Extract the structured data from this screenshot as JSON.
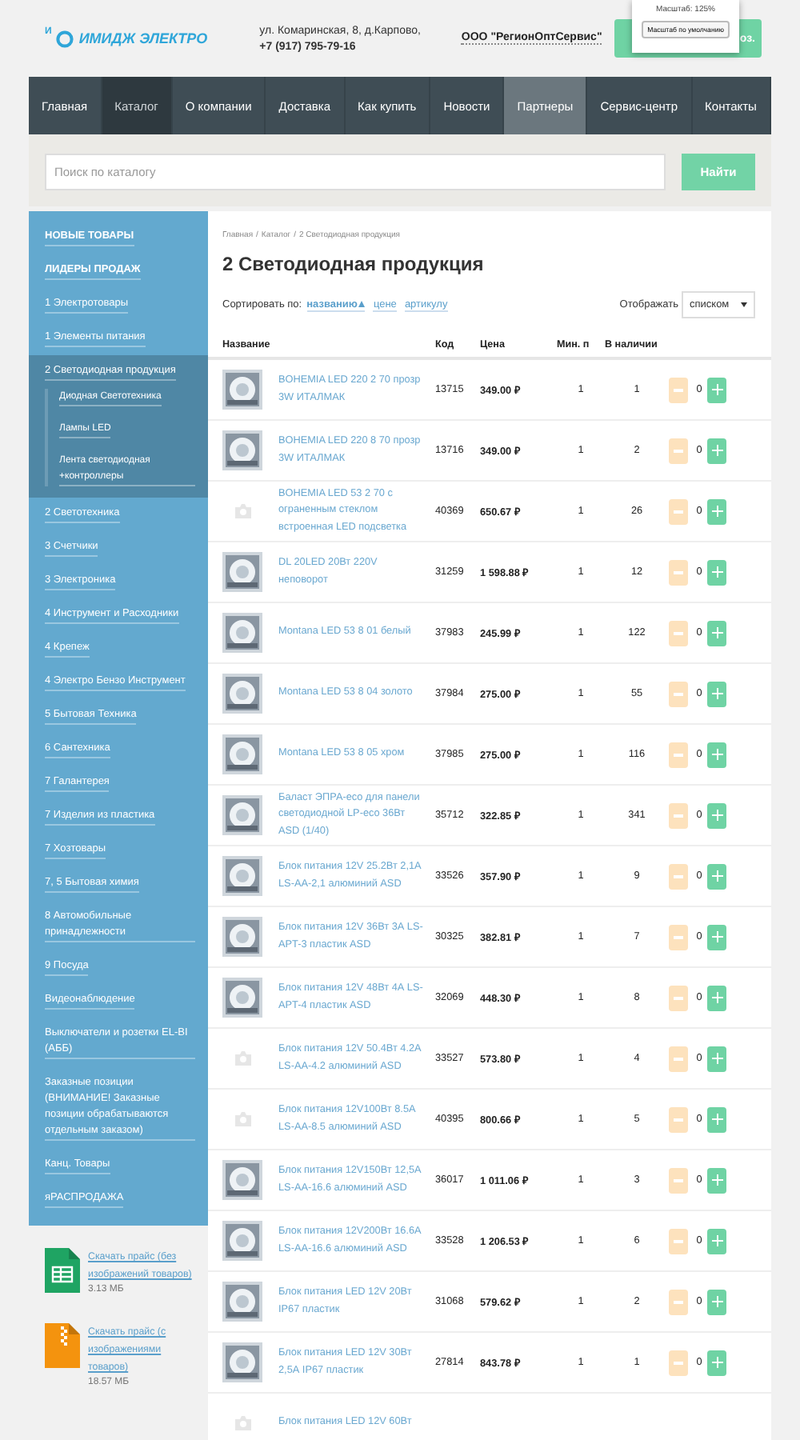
{
  "header": {
    "logo_mark": "И",
    "logo_text": "ИМИДЖ ЭЛЕКТРО",
    "address": "ул. Комаринская, 8, д.Карпово,",
    "phone": "+7 (917) 795-79-16",
    "company": "ООО \"РегионОптСервис\"",
    "cta_visible_text": "оз."
  },
  "zoom_popup": {
    "title": "Масштаб: 125%",
    "button": "Масштаб по умолчанию"
  },
  "nav": [
    {
      "label": "Главная",
      "selected": false,
      "highlighted": false
    },
    {
      "label": "Каталог",
      "selected": true,
      "highlighted": false
    },
    {
      "label": "О компании",
      "selected": false,
      "highlighted": false
    },
    {
      "label": "Доставка",
      "selected": false,
      "highlighted": false
    },
    {
      "label": "Как купить",
      "selected": false,
      "highlighted": false
    },
    {
      "label": "Новости",
      "selected": false,
      "highlighted": false
    },
    {
      "label": "Партнеры",
      "selected": false,
      "highlighted": true
    },
    {
      "label": "Сервис-центр",
      "selected": false,
      "highlighted": false
    },
    {
      "label": "Контакты",
      "selected": false,
      "highlighted": false
    }
  ],
  "search": {
    "placeholder": "Поиск по каталогу",
    "button": "Найти"
  },
  "sidebar": {
    "items": [
      {
        "label": "НОВЫЕ ТОВАРЫ",
        "selected": false,
        "bold": true
      },
      {
        "label": "ЛИДЕРЫ ПРОДАЖ",
        "selected": false,
        "bold": true
      },
      {
        "label": "1 Электротовары",
        "selected": false,
        "bold": false
      },
      {
        "label": "1 Элементы питания",
        "selected": false,
        "bold": false
      },
      {
        "label": "2 Светодиодная продукция",
        "selected": true,
        "bold": false,
        "children": [
          {
            "label": "Диодная Светотехника"
          },
          {
            "label": "Лампы LED"
          },
          {
            "label": "Лента светодиодная +контроллеры"
          }
        ]
      },
      {
        "label": "2 Светотехника",
        "selected": false,
        "bold": false
      },
      {
        "label": "3 Счетчики",
        "selected": false,
        "bold": false
      },
      {
        "label": "3 Электроника",
        "selected": false,
        "bold": false
      },
      {
        "label": "4 Инструмент и Расходники",
        "selected": false,
        "bold": false
      },
      {
        "label": "4 Крепеж",
        "selected": false,
        "bold": false
      },
      {
        "label": "4 Электро Бензо Инструмент",
        "selected": false,
        "bold": false
      },
      {
        "label": "5 Бытовая Техника",
        "selected": false,
        "bold": false
      },
      {
        "label": "6 Сантехника",
        "selected": false,
        "bold": false
      },
      {
        "label": "7 Галантерея",
        "selected": false,
        "bold": false
      },
      {
        "label": "7 Изделия из пластика",
        "selected": false,
        "bold": false
      },
      {
        "label": "7 Хозтовары",
        "selected": false,
        "bold": false
      },
      {
        "label": "7, 5 Бытовая химия",
        "selected": false,
        "bold": false
      },
      {
        "label": "8 Автомобильные принадлежности",
        "selected": false,
        "bold": false
      },
      {
        "label": "9 Посуда",
        "selected": false,
        "bold": false
      },
      {
        "label": "Видеонаблюдение",
        "selected": false,
        "bold": false
      },
      {
        "label": "Выключатели и розетки EL-BI (АББ)",
        "selected": false,
        "bold": false
      },
      {
        "label": "Заказные позиции (ВНИМАНИЕ! Заказные позиции обрабатываются отдельным заказом)",
        "selected": false,
        "bold": false
      },
      {
        "label": "Канц. Товары",
        "selected": false,
        "bold": false
      },
      {
        "label": "яРАСПРОДАЖА",
        "selected": false,
        "bold": false
      }
    ]
  },
  "downloads": [
    {
      "kind": "spreadsheet",
      "link": "Скачать прайс (без изображений товаров)",
      "size": "3.13 МБ"
    },
    {
      "kind": "archive",
      "link": "Скачать прайс (с изображениями товаров)",
      "size": "18.57 МБ"
    }
  ],
  "breadcrumbs": {
    "separator": "/",
    "items": [
      "Главная",
      "Каталог",
      "2 Светодиодная продукция"
    ]
  },
  "title": "2 Светодиодная продукция",
  "sort": {
    "label": "Сортировать по:",
    "options": [
      {
        "label": "названию",
        "selected": true
      },
      {
        "label": "цене",
        "selected": false
      },
      {
        "label": "артикулу",
        "selected": false
      }
    ]
  },
  "display": {
    "label": "Отображать",
    "value": "списком"
  },
  "table": {
    "columns": [
      "Название",
      "Код",
      "Цена",
      "Мин. п",
      "В наличии"
    ],
    "rows": [
      {
        "name": "BOHEMIA LED 220 2 70 прозр 3W ИТАЛМАК",
        "code": "13715",
        "price": "349.00 ₽",
        "min": "1",
        "stock": "1",
        "qty": "0"
      },
      {
        "name": "BOHEMIA LED 220 8 70 прозр 3W ИТАЛМАК",
        "code": "13716",
        "price": "349.00 ₽",
        "min": "1",
        "stock": "2",
        "qty": "0"
      },
      {
        "kind": "placeholder",
        "name": "BOHEMIA LED 53 2 70 с ограненным стеклом встроенная LED подсветка",
        "code": "40369",
        "price": "650.67 ₽",
        "min": "1",
        "stock": "26",
        "qty": "0"
      },
      {
        "name": "DL 20LED 20Вт 220V неповорот",
        "code": "31259",
        "price": "1 598.88 ₽",
        "min": "1",
        "stock": "12",
        "qty": "0"
      },
      {
        "name": "Montana LED 53 8 01 белый",
        "code": "37983",
        "price": "245.99 ₽",
        "min": "1",
        "stock": "122",
        "qty": "0"
      },
      {
        "name": "Montana LED 53 8 04 золото",
        "code": "37984",
        "price": "275.00 ₽",
        "min": "1",
        "stock": "55",
        "qty": "0"
      },
      {
        "name": "Montana LED 53 8 05 хром",
        "code": "37985",
        "price": "275.00 ₽",
        "min": "1",
        "stock": "116",
        "qty": "0"
      },
      {
        "name": "Баласт ЭПРА-eco для панели светодиодной LP-eco 36Вт ASD (1/40)",
        "code": "35712",
        "price": "322.85 ₽",
        "min": "1",
        "stock": "341",
        "qty": "0"
      },
      {
        "name": "Блок питания 12V 25.2Вт 2,1А LS-AA-2,1 алюминий ASD",
        "code": "33526",
        "price": "357.90 ₽",
        "min": "1",
        "stock": "9",
        "qty": "0"
      },
      {
        "name": "Блок питания 12V 36Вт 3А LS-APT-3 пластик ASD",
        "code": "30325",
        "price": "382.81 ₽",
        "min": "1",
        "stock": "7",
        "qty": "0"
      },
      {
        "name": "Блок питания 12V 48Вт 4А LS-APT-4 пластик ASD",
        "code": "32069",
        "price": "448.30 ₽",
        "min": "1",
        "stock": "8",
        "qty": "0"
      },
      {
        "kind": "placeholder",
        "name": "Блок питания 12V 50.4Вт 4.2А LS-AA-4.2 алюминий ASD",
        "code": "33527",
        "price": "573.80 ₽",
        "min": "1",
        "stock": "4",
        "qty": "0"
      },
      {
        "kind": "placeholder",
        "name": "Блок питания 12V100Вт 8.5А LS-AA-8.5 алюминий ASD",
        "code": "40395",
        "price": "800.66 ₽",
        "min": "1",
        "stock": "5",
        "qty": "0"
      },
      {
        "name": "Блок питания 12V150Вт 12,5А LS-AA-16.6 алюминий ASD",
        "code": "36017",
        "price": "1 011.06 ₽",
        "min": "1",
        "stock": "3",
        "qty": "0"
      },
      {
        "name": "Блок питания 12V200Вт 16.6А LS-AA-16.6 алюминий ASD",
        "code": "33528",
        "price": "1 206.53 ₽",
        "min": "1",
        "stock": "6",
        "qty": "0"
      },
      {
        "name": "Блок питания LED 12V 20Вт IP67 пластик",
        "code": "31068",
        "price": "579.62 ₽",
        "min": "1",
        "stock": "2",
        "qty": "0"
      },
      {
        "name": "Блок питания LED 12V 30Вт 2,5А IP67 пластик",
        "code": "27814",
        "price": "843.78 ₽",
        "min": "1",
        "stock": "1",
        "qty": "0"
      },
      {
        "kind": "placeholder",
        "name": "Блок питания LED 12V 60Вт"
      }
    ]
  }
}
